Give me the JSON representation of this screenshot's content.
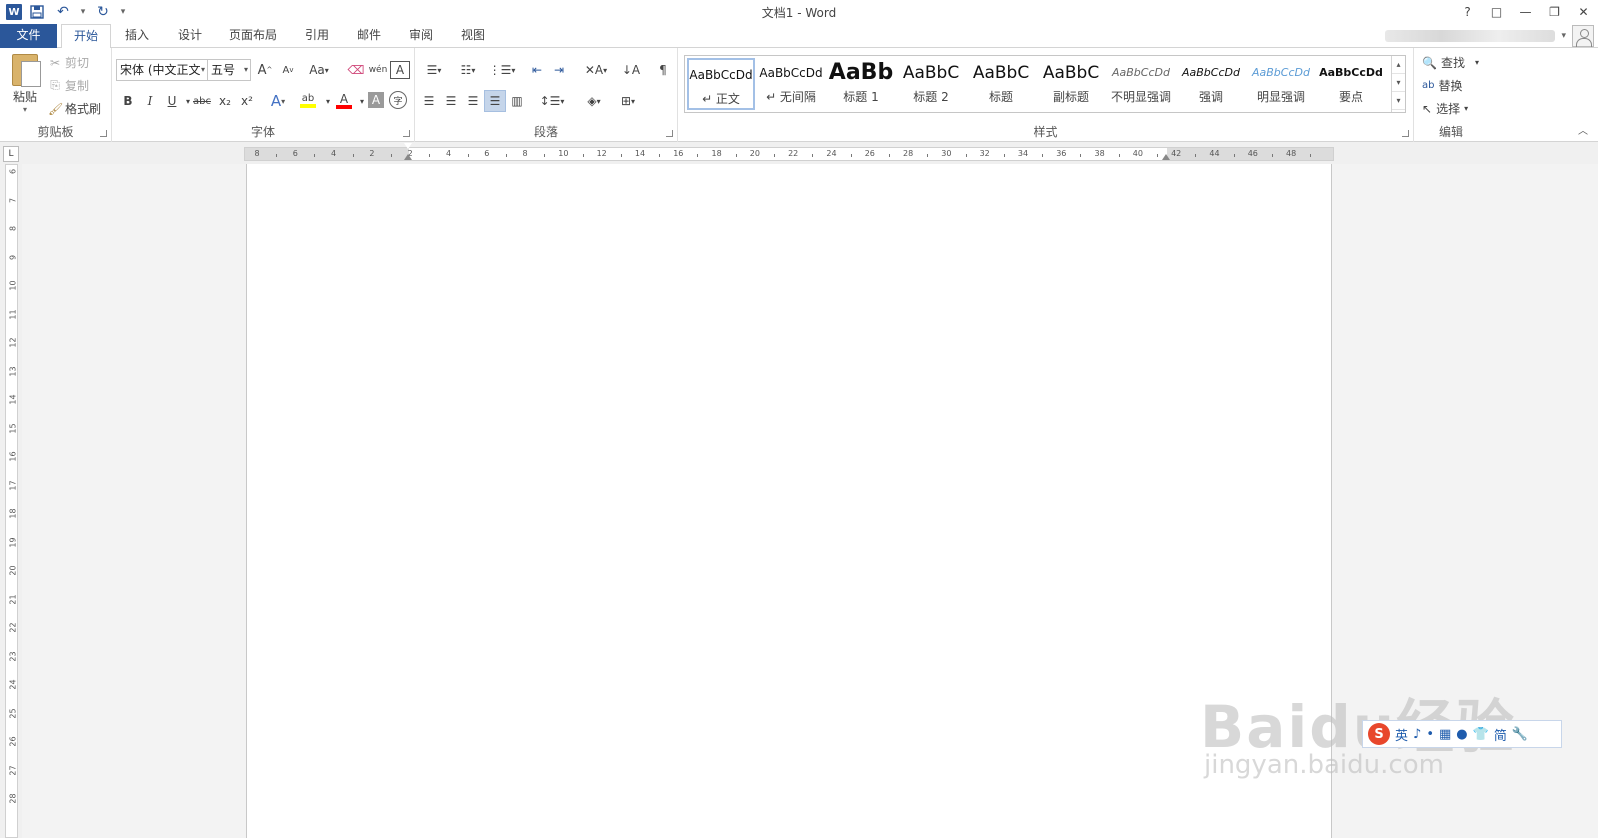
{
  "window": {
    "title": "文档1 - Word",
    "app_icon": "W",
    "controls": [
      "?",
      "□",
      "—",
      "❐",
      "✕"
    ]
  },
  "quick_access": {
    "save": "save-icon",
    "undo": "undo-icon",
    "redo": "redo-icon",
    "customize": "▾"
  },
  "tabs": [
    {
      "label": "文件"
    },
    {
      "label": "开始"
    },
    {
      "label": "插入"
    },
    {
      "label": "设计"
    },
    {
      "label": "页面布局"
    },
    {
      "label": "引用"
    },
    {
      "label": "邮件"
    },
    {
      "label": "审阅"
    },
    {
      "label": "视图"
    }
  ],
  "active_tab": "开始",
  "clipboard": {
    "paste": "粘贴",
    "cut": "剪切",
    "copy": "复制",
    "format_painter": "格式刷",
    "label": "剪贴板"
  },
  "font": {
    "name": "宋体 (中文正文",
    "size": "五号",
    "grow": "A",
    "shrink": "A",
    "case": "Aa",
    "bold": "B",
    "italic": "I",
    "underline": "U",
    "strikethrough": "abc",
    "subscript": "x₂",
    "superscript": "x²",
    "text_effects": "A",
    "highlight": "ab",
    "font_color": "A",
    "char_shading": "A",
    "enclose": "字",
    "phonetic": "wén",
    "border": "A",
    "label": "字体"
  },
  "paragraph": {
    "label": "段落"
  },
  "styles": {
    "label": "样式",
    "items": [
      {
        "sample": "AaBbCcDd",
        "name": "↵ 正文"
      },
      {
        "sample": "AaBbCcDd",
        "name": "↵ 无间隔"
      },
      {
        "sample": "AaBb",
        "name": "标题 1"
      },
      {
        "sample": "AaBbC",
        "name": "标题 2"
      },
      {
        "sample": "AaBbC",
        "name": "标题"
      },
      {
        "sample": "AaBbC",
        "name": "副标题"
      },
      {
        "sample": "AaBbCcDd",
        "name": "不明显强调"
      },
      {
        "sample": "AaBbCcDd",
        "name": "强调"
      },
      {
        "sample": "AaBbCcDd",
        "name": "明显强调"
      },
      {
        "sample": "AaBbCcDd",
        "name": "要点"
      }
    ]
  },
  "editing": {
    "label": "编辑",
    "find": "查找",
    "replace": "替换",
    "select": "选择"
  },
  "ruler": {
    "corner": "L",
    "h_labels": [
      "8",
      "6",
      "4",
      "2",
      "2",
      "4",
      "6",
      "8",
      "10",
      "12",
      "14",
      "16",
      "18",
      "20",
      "22",
      "24",
      "26",
      "28",
      "30",
      "32",
      "34",
      "36",
      "38",
      "40",
      "42",
      "44",
      "46",
      "48"
    ],
    "v_labels": [
      "6",
      "7",
      "8",
      "9",
      "10",
      "11",
      "12",
      "13",
      "14",
      "15",
      "16",
      "17",
      "18",
      "19",
      "20",
      "21",
      "22",
      "23",
      "24",
      "25",
      "26",
      "27",
      "28"
    ]
  },
  "ime": {
    "logo": "S",
    "items": [
      "英",
      "♪",
      "•",
      "▦",
      "●",
      "👕",
      "简",
      "🔧"
    ]
  },
  "watermark": {
    "brand": "Baidu经验",
    "url": "jingyan.baidu.com"
  },
  "colors": {
    "accent": "#2b579a",
    "highlight": "#ffff00",
    "font_color": "#ff0000"
  }
}
